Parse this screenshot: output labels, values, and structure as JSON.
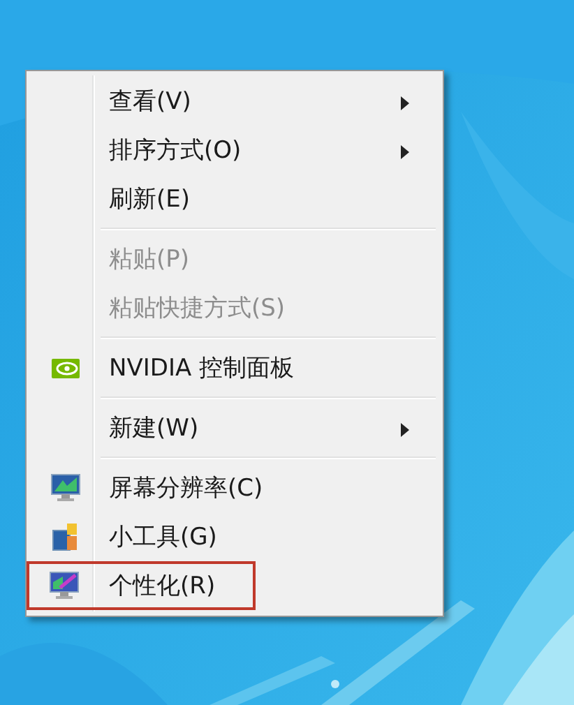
{
  "context_menu": {
    "items": [
      {
        "kind": "item",
        "label": "查看(V)",
        "disabled": false,
        "submenu": true,
        "selected": false
      },
      {
        "kind": "item",
        "label": "排序方式(O)",
        "disabled": false,
        "submenu": true,
        "selected": false
      },
      {
        "kind": "item",
        "label": "刷新(E)",
        "disabled": false,
        "submenu": false,
        "selected": false
      },
      {
        "kind": "separator"
      },
      {
        "kind": "item",
        "label": "粘贴(P)",
        "disabled": true,
        "submenu": false,
        "selected": false
      },
      {
        "kind": "item",
        "label": "粘贴快捷方式(S)",
        "disabled": true,
        "submenu": false,
        "selected": false
      },
      {
        "kind": "separator"
      },
      {
        "kind": "item",
        "label": "NVIDIA 控制面板",
        "disabled": false,
        "submenu": false,
        "selected": false
      },
      {
        "kind": "separator"
      },
      {
        "kind": "item",
        "label": "新建(W)",
        "disabled": false,
        "submenu": true,
        "selected": false
      },
      {
        "kind": "separator"
      },
      {
        "kind": "item",
        "label": "屏幕分辨率(C)",
        "disabled": false,
        "submenu": false,
        "selected": false
      },
      {
        "kind": "item",
        "label": "小工具(G)",
        "disabled": false,
        "submenu": false,
        "selected": false
      },
      {
        "kind": "item",
        "label": "个性化(R)",
        "disabled": false,
        "submenu": false,
        "selected": true
      }
    ]
  }
}
